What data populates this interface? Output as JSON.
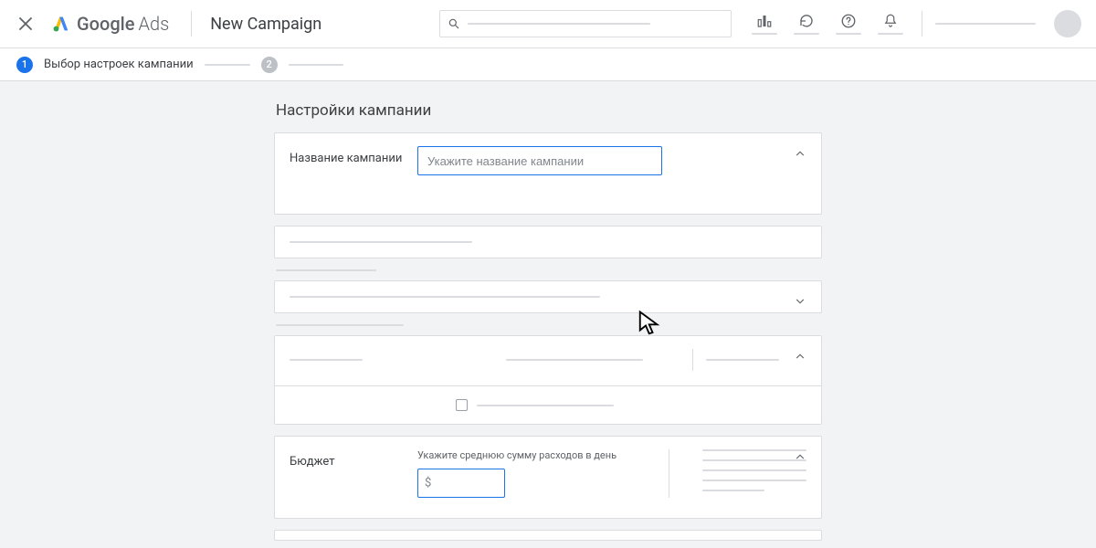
{
  "header": {
    "logo_primary": "Google",
    "logo_secondary": "Ads",
    "page_title": "New Campaign"
  },
  "stepper": {
    "step1_num": "1",
    "step1_label": "Выбор настроек кампании",
    "step2_num": "2"
  },
  "section_title": "Настройки кампании",
  "campaign_name": {
    "label": "Название кампании",
    "placeholder": "Укажите название кампании"
  },
  "budget": {
    "label": "Бюджет",
    "helper": "Укажите среднюю сумму расходов в день",
    "currency": "$"
  }
}
